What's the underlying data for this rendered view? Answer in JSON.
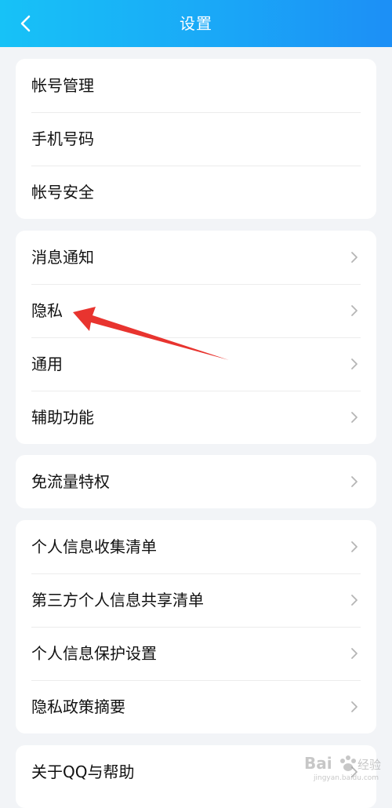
{
  "header": {
    "title": "设置",
    "back_icon": "chevron-left-icon"
  },
  "groups": [
    {
      "items": [
        {
          "label": "帐号管理"
        },
        {
          "label": "手机号码"
        },
        {
          "label": "帐号安全"
        }
      ]
    },
    {
      "items": [
        {
          "label": "消息通知"
        },
        {
          "label": "隐私"
        },
        {
          "label": "通用"
        },
        {
          "label": "辅助功能"
        }
      ]
    },
    {
      "items": [
        {
          "label": "免流量特权"
        }
      ]
    },
    {
      "items": [
        {
          "label": "个人信息收集清单"
        },
        {
          "label": "第三方个人信息共享清单"
        },
        {
          "label": "个人信息保护设置"
        },
        {
          "label": "隐私政策摘要"
        }
      ]
    },
    {
      "items": [
        {
          "label": "关于QQ与帮助"
        }
      ]
    }
  ],
  "annotation": {
    "color": "#e8342f",
    "target": "隐私"
  },
  "colors": {
    "header_start": "#17c2f7",
    "header_end": "#1c8ff6",
    "page_bg": "#f2f4f7",
    "chevron": "#b5b5b5"
  },
  "watermark": {
    "text": "Bai 经验",
    "subtext": "jingyan.baidu.com"
  }
}
